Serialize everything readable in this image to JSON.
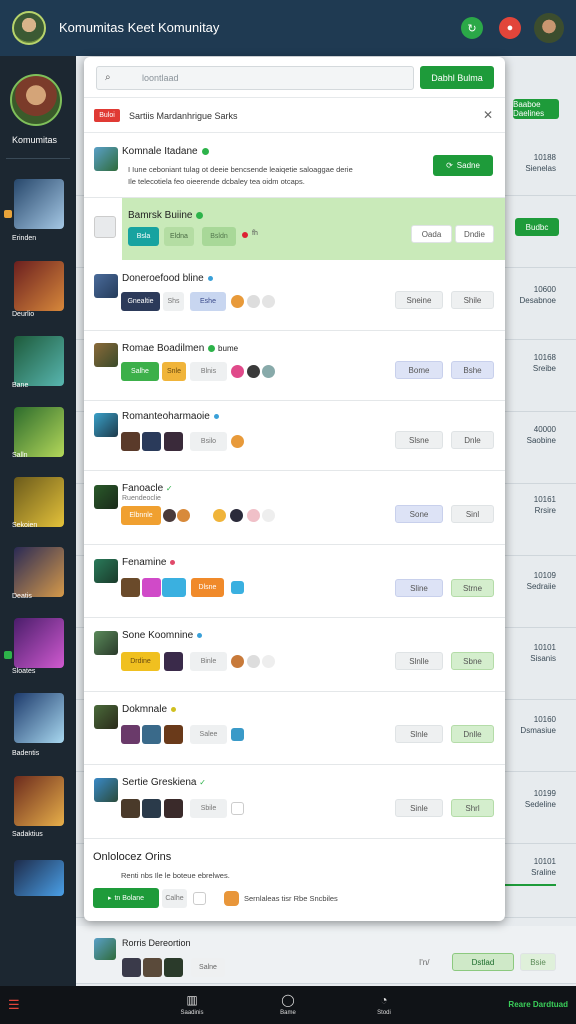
{
  "app": {
    "title": "Komumitas Keet Komunitay"
  },
  "sidebar": {
    "top_name": "Komumitas",
    "games": [
      {
        "label": "Erinden",
        "colors": [
          "#27476b",
          "#a5c8e5"
        ]
      },
      {
        "label": "Deurlio",
        "colors": [
          "#6b1f1f",
          "#d7883b"
        ]
      },
      {
        "label": "Bane",
        "colors": [
          "#1d5a3a",
          "#58b6b0"
        ]
      },
      {
        "label": "Salln",
        "colors": [
          "#2c6b2c",
          "#b4d85a"
        ]
      },
      {
        "label": "Sekoien",
        "colors": [
          "#6b5a1b",
          "#e4c23a"
        ]
      },
      {
        "label": "Deatis",
        "colors": [
          "#2a2a55",
          "#d69a4a"
        ]
      },
      {
        "label": "Sloates",
        "colors": [
          "#4a1d6b",
          "#d05ad0"
        ]
      },
      {
        "label": "Badentis",
        "colors": [
          "#1d3a6b",
          "#a8d8f0"
        ]
      },
      {
        "label": "Sadaktius",
        "colors": [
          "#6b2a1d",
          "#e8b04a"
        ]
      },
      {
        "label": "",
        "colors": [
          "#1d2b4a",
          "#4aa0e8"
        ]
      }
    ]
  },
  "search": {
    "placeholder": "loontlaad",
    "button": "Dabhl Bulma"
  },
  "notice": {
    "tag": "Buloi",
    "text": "Sartiis Mardanhrigue Sarks"
  },
  "featured": {
    "name": "Komnale Itadane",
    "desc_line1": "I Iune ceboniant tulag ot deeie bencsende leaiqetie saloaggae derie",
    "desc_line2": "Ile telecotiela feo oieerende dcbaley tea oidm otcaps.",
    "button": "Sadne"
  },
  "highlight": {
    "name": "Bamrsk Buiine",
    "chip1": "Bsla",
    "chip2": "Eldna",
    "chip3": "Bsldn",
    "meta": "fh",
    "btn1": "Oada",
    "btn2": "Dndie"
  },
  "rows": [
    {
      "name": "Doneroefood bline",
      "chips": [
        "Gnealtie",
        "Shs",
        "Eshe"
      ],
      "btn1": "Sneine",
      "btn2": "Shile"
    },
    {
      "name": "Romae Boadilmen",
      "extra": "bume",
      "chips": [
        "Salhe",
        "Snle",
        "Blnis"
      ],
      "btn1": "Bome",
      "btn2": "Bshe"
    },
    {
      "name": "Romanteoharmaoie",
      "chips": [
        "Bsilo"
      ],
      "btn1": "Slsne",
      "btn2": "Dnle"
    },
    {
      "name": "Fanoacle",
      "sub": "Ruendeoclie",
      "chips": [
        "Elbnnle"
      ],
      "btn1": "Sone",
      "btn2": "Sinl"
    },
    {
      "name": "Fenamine",
      "chips": [
        "Dlsne"
      ],
      "btn1": "Sline",
      "btn2": "Strne"
    },
    {
      "name": "Sone Koomnine",
      "chips": [
        "Drdine",
        "Binle"
      ],
      "btn1": "Slnlle",
      "btn2": "Sbne"
    },
    {
      "name": "Dokmnale",
      "chips": [
        "Salee"
      ],
      "btn1": "Slnle",
      "btn2": "Dnlle"
    },
    {
      "name": "Sertie Greskiena",
      "chips": [
        "Sbile"
      ],
      "btn1": "Sinle",
      "btn2": "Shrl"
    }
  ],
  "online": {
    "title": "Onlolocez Orins",
    "desc": "Renti nbs Ile le boteue ebrelwes.",
    "button": "tn Bolane",
    "chip": "Calhe",
    "meta": "Sernlaleas tisr Rbe Sncbiles"
  },
  "bottom_row": {
    "name": "Rorris Dereortion",
    "chip": "Salne",
    "meta": "I'n/",
    "btn1": "Dstlad",
    "btn2": "Bsie"
  },
  "right": [
    {
      "num": "10188",
      "sub": "Sienelas"
    },
    {
      "num": "",
      "sub": "",
      "button": "Budbc"
    },
    {
      "num": "10600",
      "sub": "Desabnoe"
    },
    {
      "num": "10168",
      "sub": "Sreibe"
    },
    {
      "num": "40000",
      "sub": "Saobine"
    },
    {
      "num": "10161",
      "sub": "Rrsire"
    },
    {
      "num": "10109",
      "sub": "Sedraiie"
    },
    {
      "num": "10101",
      "sub": "Sisanis"
    },
    {
      "num": "10160",
      "sub": "Dsmasiue"
    },
    {
      "num": "10199",
      "sub": "Sedeline"
    },
    {
      "num": "10101",
      "sub": "Sraline"
    }
  ],
  "right_top_button": "Baaboe Daelines",
  "bottom_nav": [
    {
      "icon": "grid",
      "label": "Saadinis"
    },
    {
      "icon": "circle",
      "label": "Bame"
    },
    {
      "icon": "chat",
      "label": "Stodi"
    }
  ],
  "bottom_right": "Reare Dardtuad",
  "bottom_left_icon": "menu"
}
